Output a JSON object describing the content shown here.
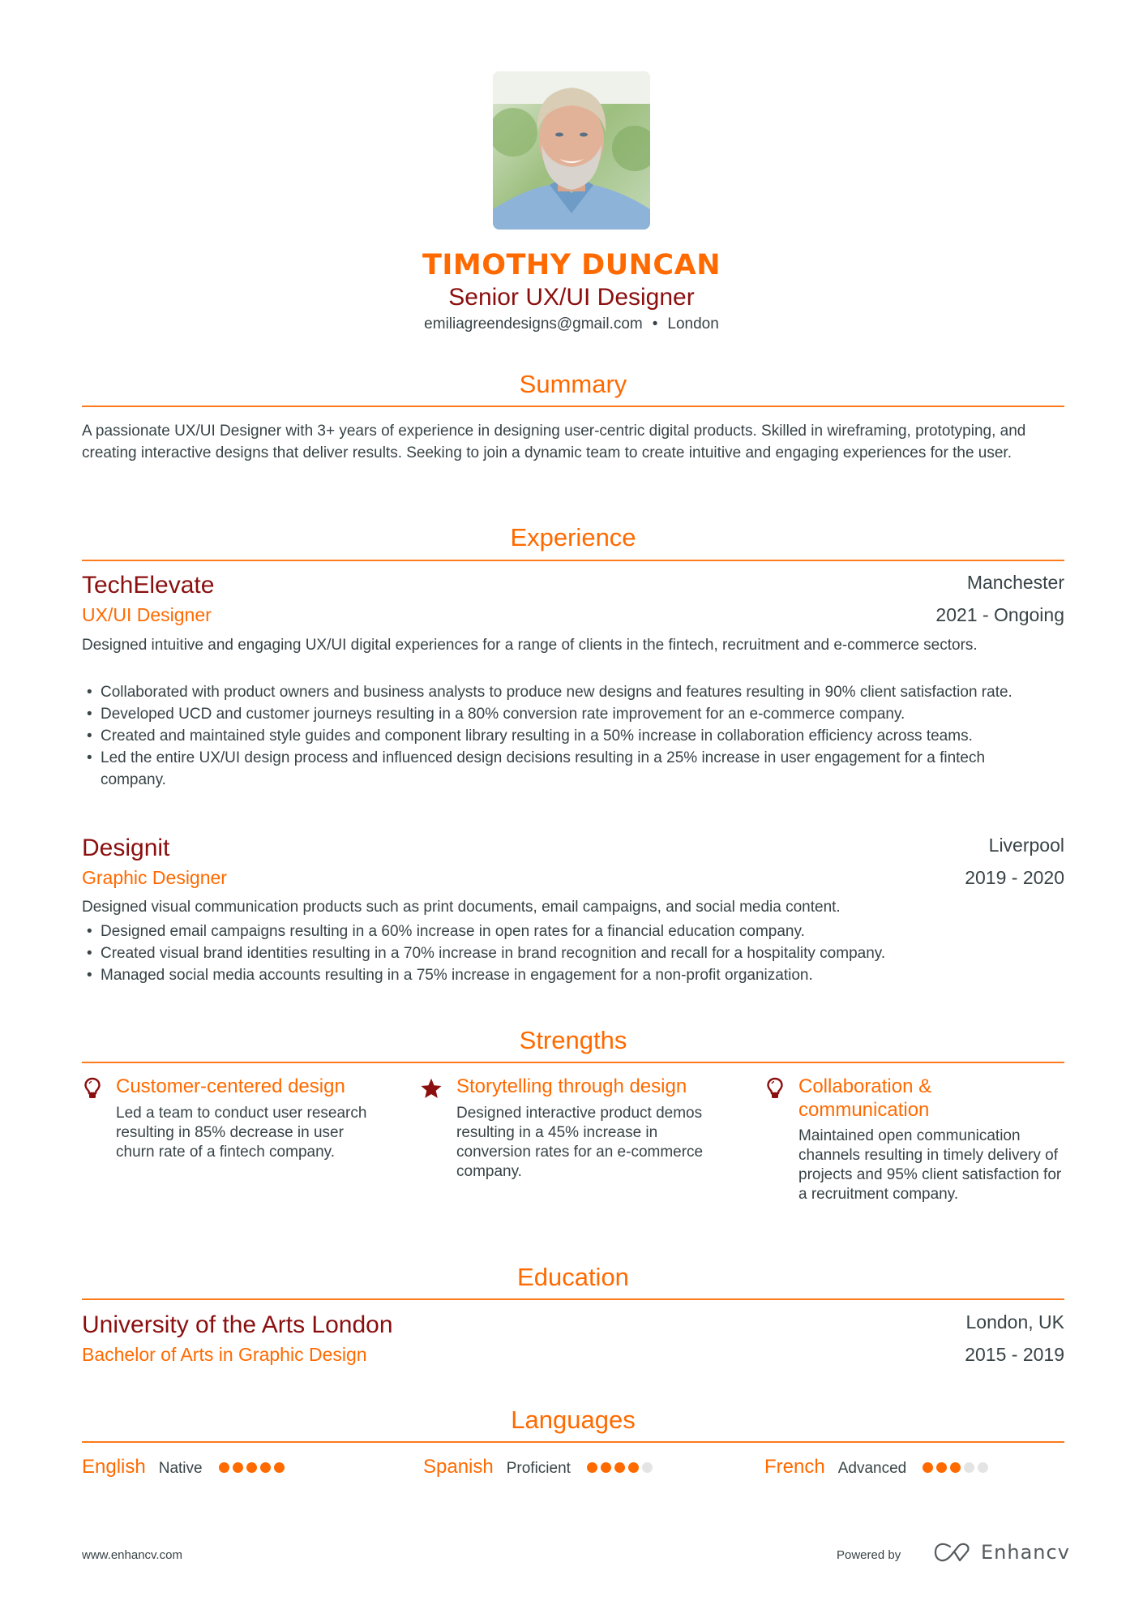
{
  "header": {
    "name": "TIMOTHY DUNCAN",
    "title": "Senior UX/UI Designer",
    "email": "emiliagreendesigns@gmail.com",
    "separator": "•",
    "location": "London",
    "photo_alt": "Profile photo"
  },
  "summary": {
    "heading": "Summary",
    "text": "A passionate UX/UI Designer with 3+ years of experience in designing user-centric digital products. Skilled in wireframing, prototyping, and creating interactive designs that deliver results. Seeking to join a dynamic team to create intuitive and engaging experiences for the user."
  },
  "experience": {
    "heading": "Experience",
    "jobs": [
      {
        "company": "TechElevate",
        "role": "UX/UI Designer",
        "location": "Manchester",
        "dates": "2021 - Ongoing",
        "description": "Designed intuitive and engaging UX/UI digital experiences for a range of clients in the fintech, recruitment and e-commerce sectors.",
        "bullets": [
          "Collaborated with product owners and business analysts to produce new designs and features resulting in 90% client satisfaction rate.",
          "Developed UCD and customer journeys resulting in a 80% conversion rate improvement for an e-commerce company.",
          "Created and maintained style guides and component library resulting in a 50% increase in collaboration efficiency across teams.",
          "Led the entire UX/UI design process and influenced design decisions resulting in a 25% increase in user engagement for a fintech company."
        ]
      },
      {
        "company": "Designit",
        "role": "Graphic Designer",
        "location": "Liverpool",
        "dates": "2019 - 2020",
        "description": "Designed visual communication products such as print documents, email campaigns, and social media content.",
        "bullets": [
          "Designed email campaigns resulting in a 60% increase in open rates for a financial education company.",
          "Created visual brand identities resulting in a 70% increase in brand recognition and recall for a hospitality company.",
          "Managed social media accounts resulting in a 75% increase in engagement for a non-profit organization."
        ]
      }
    ]
  },
  "strengths": {
    "heading": "Strengths",
    "items": [
      {
        "icon": "lightbulb-icon",
        "title": "Customer-centered design",
        "description": "Led a team to conduct user research resulting in 85% decrease in user churn rate of a fintech company."
      },
      {
        "icon": "star-icon",
        "title": "Storytelling through design",
        "description": "Designed interactive product demos resulting in a 45% increase in conversion rates for an e-commerce company."
      },
      {
        "icon": "lightbulb-icon",
        "title": "Collaboration & communication",
        "description": "Maintained open communication channels resulting in timely delivery of projects and 95% client satisfaction for a recruitment company."
      }
    ]
  },
  "education": {
    "heading": "Education",
    "school": "University of the Arts London",
    "degree": "Bachelor of Arts in Graphic Design",
    "location": "London, UK",
    "dates": "2015 - 2019"
  },
  "languages": {
    "heading": "Languages",
    "items": [
      {
        "name": "English",
        "level": "Native",
        "rating": 5,
        "max": 5
      },
      {
        "name": "Spanish",
        "level": "Proficient",
        "rating": 4,
        "max": 5
      },
      {
        "name": "French",
        "level": "Advanced",
        "rating": 3,
        "max": 5
      }
    ]
  },
  "footer": {
    "url": "www.enhancv.com",
    "powered_by": "Powered by",
    "brand": "Enhancv"
  },
  "colors": {
    "accent": "#ff6a00",
    "dark_red": "#8b0f0f",
    "text": "#384347",
    "dot_inactive": "#e4e4e4"
  }
}
